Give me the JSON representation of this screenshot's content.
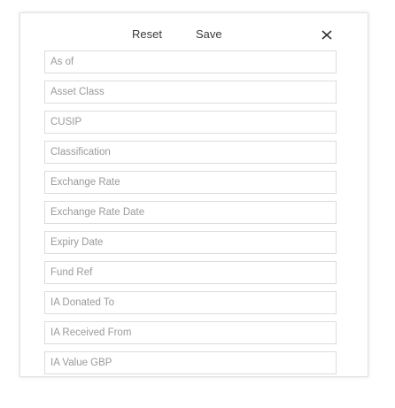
{
  "toolbar": {
    "reset_label": "Reset",
    "save_label": "Save",
    "close_icon": "close-icon"
  },
  "fields": [
    {
      "placeholder": "As of"
    },
    {
      "placeholder": "Asset Class"
    },
    {
      "placeholder": "CUSIP"
    },
    {
      "placeholder": "Classification"
    },
    {
      "placeholder": "Exchange Rate"
    },
    {
      "placeholder": "Exchange Rate Date"
    },
    {
      "placeholder": "Expiry Date"
    },
    {
      "placeholder": "Fund Ref"
    },
    {
      "placeholder": "IA Donated To"
    },
    {
      "placeholder": "IA Received From"
    },
    {
      "placeholder": "IA Value GBP"
    }
  ]
}
